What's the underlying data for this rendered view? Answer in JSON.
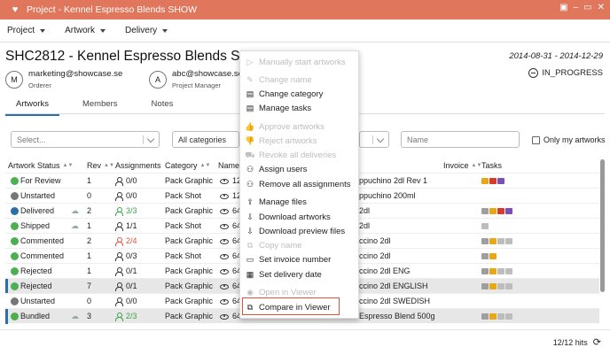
{
  "window": {
    "title": "Project - Kennel Espresso Blends SHOW"
  },
  "menubar": [
    {
      "label": "Project"
    },
    {
      "label": "Artwork"
    },
    {
      "label": "Delivery"
    }
  ],
  "project": {
    "title": "SHC2812 - Kennel Espresso Blends SHOW",
    "date_range": "2014-08-31 - 2014-12-29",
    "orderer": {
      "avatar": "M",
      "email": "marketing@showcase.se",
      "role": "Orderer"
    },
    "manager": {
      "avatar": "A",
      "email": "abc@showcase.se",
      "role": "Project Manager"
    },
    "status": "IN_PROGRESS"
  },
  "tabs": [
    {
      "label": "Artworks"
    },
    {
      "label": "Members"
    },
    {
      "label": "Notes"
    }
  ],
  "filters": {
    "status_placeholder": "Select...",
    "category": "All categories",
    "name_placeholder": "Name",
    "only_mine": "Only my artworks"
  },
  "columns": [
    "Artwork Status",
    "Rev",
    "Assignments",
    "Category",
    "Name",
    "Invoice",
    "Tasks"
  ],
  "rows": [
    {
      "status": "For Review",
      "color": "#4caf50",
      "rev": "1",
      "assign": "0/0",
      "assign_color": "",
      "cat": "Pack Graphic",
      "name_pre": "123",
      "name_post": "ppuchino 2dl Rev 1",
      "cloud": false,
      "tasks": [
        "y",
        "r",
        "b"
      ]
    },
    {
      "status": "Unstarted",
      "color": "#777777",
      "rev": "0",
      "assign": "0/0",
      "assign_color": "",
      "cat": "Pack Shot",
      "name_pre": "123",
      "name_post": "ppuchino 200ml",
      "cloud": false,
      "tasks": []
    },
    {
      "status": "Delivered",
      "color": "#2b6fa8",
      "rev": "2",
      "assign": "3/3",
      "assign_color": "grn",
      "cat": "Pack Graphic",
      "name_pre": "645",
      "name_post": "2dl",
      "cloud": true,
      "tasks": [
        "c",
        "y",
        "r",
        "b"
      ]
    },
    {
      "status": "Shipped",
      "color": "#4caf50",
      "rev": "1",
      "assign": "1/1",
      "assign_color": "",
      "cat": "Pack Shot",
      "name_pre": "645",
      "name_post": "2dl",
      "cloud": true,
      "tasks": [
        "g"
      ]
    },
    {
      "status": "Commented",
      "color": "#4caf50",
      "rev": "2",
      "assign": "2/4",
      "assign_color": "red",
      "cat": "Pack Graphic",
      "name_pre": "645",
      "name_post": "ccino 2dl",
      "cloud": false,
      "tasks": [
        "c",
        "y",
        "g",
        "g"
      ]
    },
    {
      "status": "Commented",
      "color": "#4caf50",
      "rev": "1",
      "assign": "0/3",
      "assign_color": "",
      "cat": "Pack Shot",
      "name_pre": "645",
      "name_post": "ccino 2dl",
      "cloud": false,
      "tasks": [
        "c",
        "y"
      ]
    },
    {
      "status": "Rejected",
      "color": "#4caf50",
      "rev": "1",
      "assign": "0/1",
      "assign_color": "",
      "cat": "Pack Graphic",
      "name_pre": "645",
      "name_post": "ccino 2dl ENG",
      "cloud": false,
      "tasks": [
        "c",
        "y",
        "g",
        "g"
      ]
    },
    {
      "status": "Rejected",
      "color": "#4caf50",
      "rev": "7",
      "assign": "0/1",
      "assign_color": "",
      "cat": "Pack Graphic",
      "name_pre": "645",
      "name_post": "ccino 2dl ENGLISH",
      "cloud": false,
      "tasks": [
        "c",
        "y",
        "g",
        "g"
      ],
      "selected": true
    },
    {
      "status": "Unstarted",
      "color": "#777777",
      "rev": "0",
      "assign": "0/0",
      "assign_color": "",
      "cat": "Pack Graphic",
      "name_pre": "645",
      "name_post": "ccino 2dl SWEDISH",
      "cloud": false,
      "tasks": []
    },
    {
      "status": "Bundled",
      "color": "#4caf50",
      "rev": "3",
      "assign": "2/3",
      "assign_color": "grn",
      "cat": "Pack Graphic",
      "name_pre": "645",
      "name_post": "Espresso Blend 500g",
      "cloud": true,
      "tasks": [
        "c",
        "y",
        "g",
        "g"
      ],
      "selected": true
    }
  ],
  "context_menu": [
    {
      "label": "Manually start artworks",
      "disabled": true,
      "icon": "play-icon"
    },
    {
      "label": "Change name",
      "disabled": true,
      "icon": "pencil-icon"
    },
    {
      "label": "Change category",
      "disabled": false,
      "icon": "category-icon"
    },
    {
      "label": "Manage tasks",
      "disabled": false,
      "icon": "tasks-icon"
    },
    {
      "label": "Approve artworks",
      "disabled": true,
      "icon": "thumbs-up-icon"
    },
    {
      "label": "Reject artworks",
      "disabled": true,
      "icon": "thumbs-down-icon"
    },
    {
      "label": "Revoke all deliveries",
      "disabled": true,
      "icon": "truck-icon"
    },
    {
      "label": "Assign users",
      "disabled": false,
      "icon": "user-plus-icon"
    },
    {
      "label": "Remove all assignments",
      "disabled": false,
      "icon": "user-minus-icon"
    },
    {
      "label": "Manage files",
      "disabled": false,
      "icon": "upload-icon"
    },
    {
      "label": "Download artworks",
      "disabled": false,
      "icon": "download-icon"
    },
    {
      "label": "Download preview files",
      "disabled": false,
      "icon": "download-icon"
    },
    {
      "label": "Copy name",
      "disabled": true,
      "icon": "copy-icon"
    },
    {
      "label": "Set invoice number",
      "disabled": false,
      "icon": "invoice-icon"
    },
    {
      "label": "Set delivery date",
      "disabled": false,
      "icon": "calendar-icon"
    },
    {
      "label": "Open in Viewer",
      "disabled": true,
      "icon": "eye-icon"
    },
    {
      "label": "Compare in Viewer",
      "disabled": false,
      "icon": "compare-icon"
    }
  ],
  "footer": {
    "hits": "12/12 hits"
  }
}
